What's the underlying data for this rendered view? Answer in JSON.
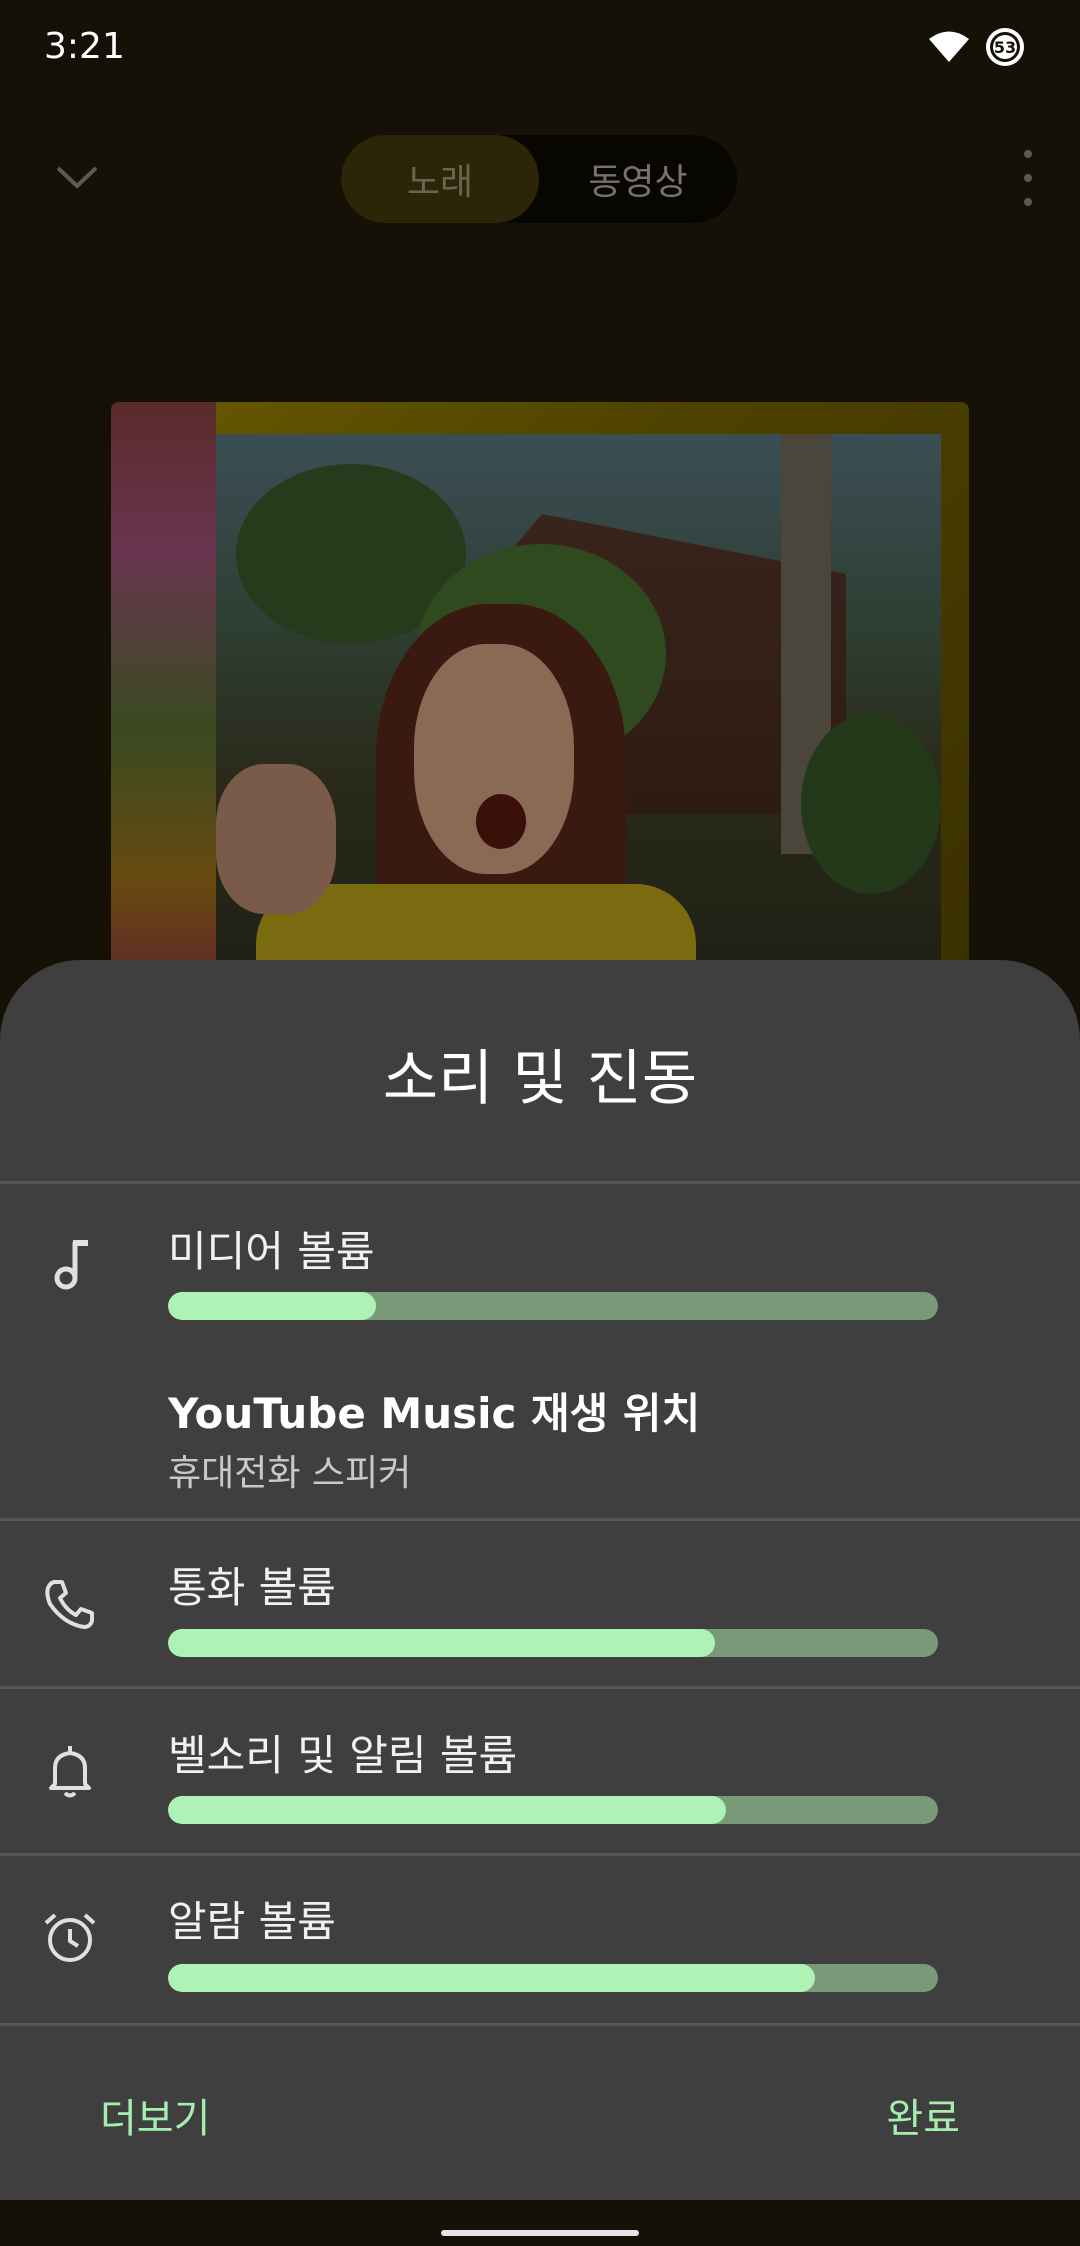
{
  "status_bar": {
    "time": "3:21",
    "battery_level": "53"
  },
  "player": {
    "tabs": [
      {
        "label": "노래",
        "active": true
      },
      {
        "label": "동영상",
        "active": false
      }
    ]
  },
  "sheet": {
    "title": "소리 및 진동",
    "media": {
      "label": "미디어 볼륨",
      "level": 0.27,
      "icon": "music-note-icon"
    },
    "output": {
      "title": "YouTube Music 재생 위치",
      "device": "휴대전화 스피커"
    },
    "call": {
      "label": "통화 볼륨",
      "level": 0.71,
      "icon": "phone-icon"
    },
    "ring": {
      "label": "벨소리 및 알림 볼륨",
      "level": 0.725,
      "icon": "bell-icon"
    },
    "alarm": {
      "label": "알람 볼륨",
      "level": 0.84,
      "icon": "alarm-clock-icon"
    },
    "footer": {
      "more_label": "더보기",
      "done_label": "완료"
    }
  },
  "colors": {
    "sheet_background": "#3f3f3f",
    "slider_fill": "#aef2b5",
    "slider_track": "#789a79",
    "accent_text": "#a6eeb0"
  }
}
